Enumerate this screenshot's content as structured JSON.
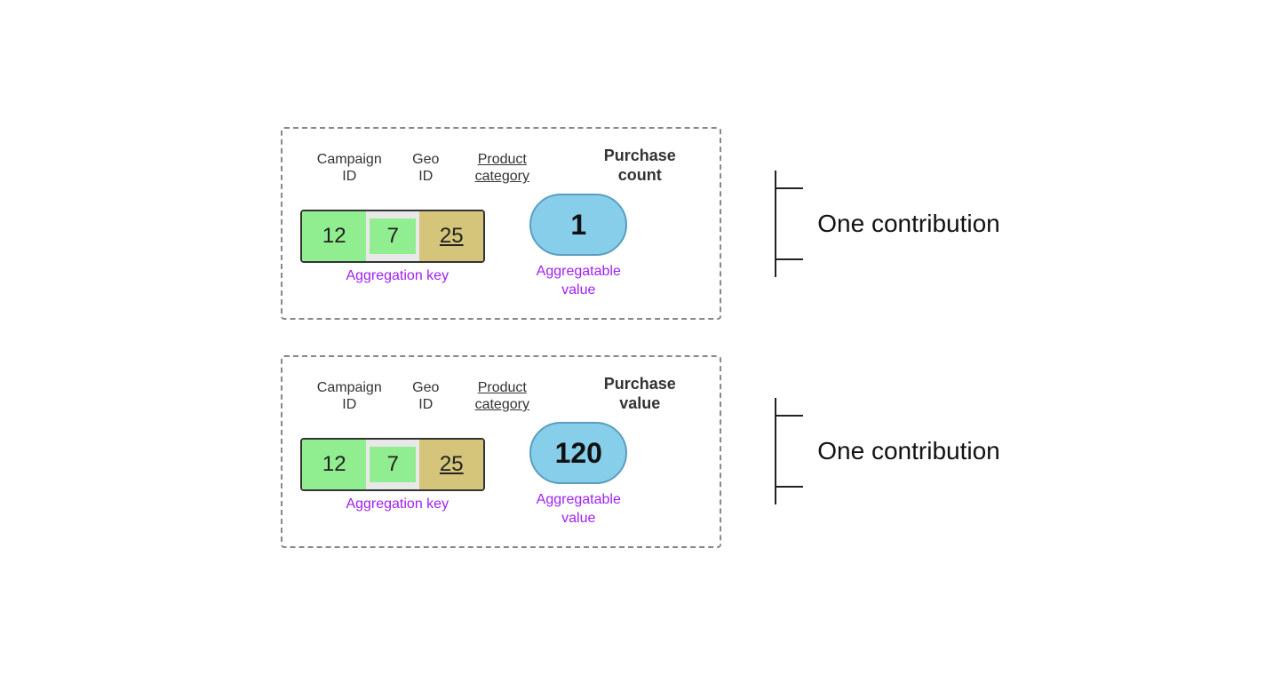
{
  "blocks": [
    {
      "id": "block1",
      "headers": {
        "campaign_id": "Campaign\nID",
        "geo_id": "Geo\nID",
        "product_category": "Product\ncategory",
        "metric_label": "Purchase\ncount"
      },
      "aggregation_key": {
        "campaign_value": "12",
        "geo_value": "7",
        "product_value": "25",
        "label": "Aggregation key"
      },
      "aggregatable": {
        "value": "1",
        "label": "Aggregatable\nvalue"
      },
      "contribution_label": "One contribution"
    },
    {
      "id": "block2",
      "headers": {
        "campaign_id": "Campaign\nID",
        "geo_id": "Geo\nID",
        "product_category": "Product\ncategory",
        "metric_label": "Purchase\nvalue"
      },
      "aggregation_key": {
        "campaign_value": "12",
        "geo_value": "7",
        "product_value": "25",
        "label": "Aggregation key"
      },
      "aggregatable": {
        "value": "120",
        "label": "Aggregatable\nvalue"
      },
      "contribution_label": "One contribution"
    }
  ]
}
